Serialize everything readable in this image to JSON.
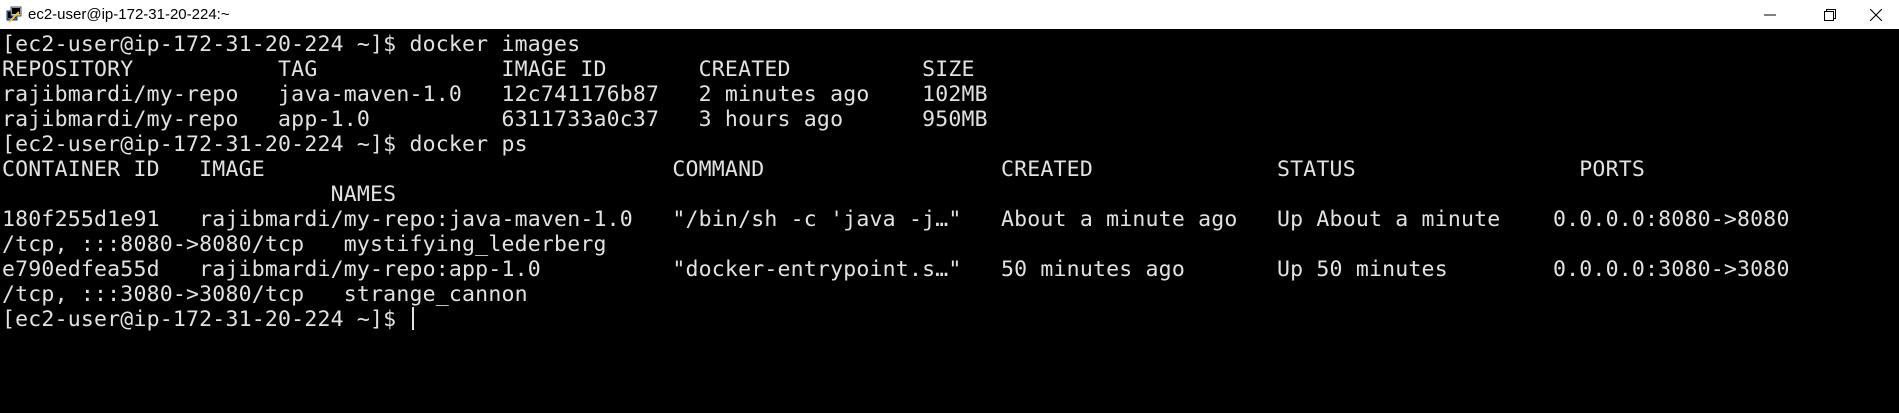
{
  "window": {
    "title": "ec2-user@ip-172-31-20-224:~",
    "icon": "putty-terminal-icon",
    "controls": {
      "minimize": "minimize-icon",
      "maximize": "restore-icon",
      "close": "close-icon"
    }
  },
  "terminal": {
    "background": "#000000",
    "foreground": "#e2e2e2",
    "lines": [
      "[ec2-user@ip-172-31-20-224 ~]$ docker images",
      "REPOSITORY           TAG              IMAGE ID       CREATED          SIZE",
      "rajibmardi/my-repo   java-maven-1.0   12c741176b87   2 minutes ago    102MB",
      "rajibmardi/my-repo   app-1.0          6311733a0c37   3 hours ago      950MB",
      "[ec2-user@ip-172-31-20-224 ~]$ docker ps",
      "CONTAINER ID   IMAGE                               COMMAND                  CREATED              STATUS                 PORTS",
      "                         NAMES",
      "180f255d1e91   rajibmardi/my-repo:java-maven-1.0   \"/bin/sh -c 'java -j…\"   About a minute ago   Up About a minute    0.0.0.0:8080->8080",
      "/tcp, :::8080->8080/tcp   mystifying_lederberg",
      "e790edfea55d   rajibmardi/my-repo:app-1.0          \"docker-entrypoint.s…\"   50 minutes ago       Up 50 minutes        0.0.0.0:3080->3080",
      "/tcp, :::3080->3080/tcp   strange_cannon",
      "[ec2-user@ip-172-31-20-224 ~]$ "
    ]
  }
}
